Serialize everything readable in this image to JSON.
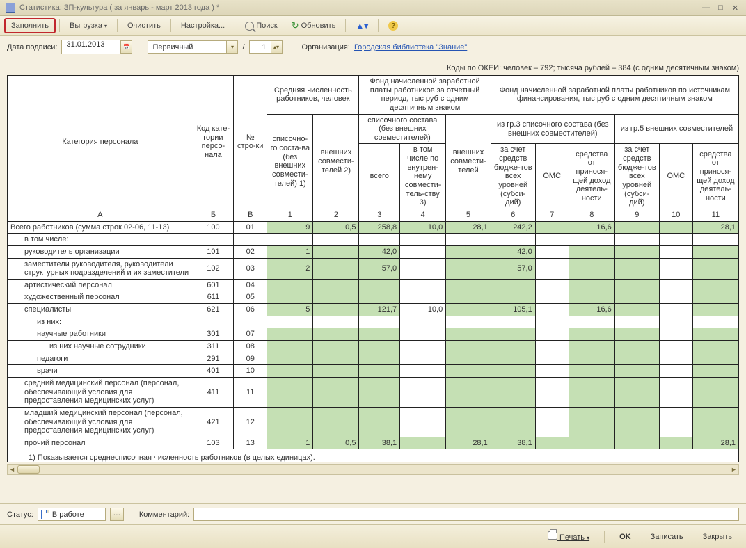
{
  "window": {
    "title": "Статистика: ЗП-культура ( за январь - март 2013 года ) *"
  },
  "toolbar": {
    "fill": "Заполнить",
    "export": "Выгрузка",
    "clear": "Очистить",
    "settings": "Настройка...",
    "search": "Поиск",
    "refresh": "Обновить"
  },
  "form": {
    "date_label": "Дата подписи:",
    "date_value": "31.01.2013",
    "doctype": "Первичный",
    "slash": "/",
    "seq": "1",
    "org_label": "Организация:",
    "org_value": "Городская библиотека \"Знание\""
  },
  "okei": "Коды по ОКЕИ: человек – 792; тысяча рублей – 384 (с одним десятичным знаком)",
  "head": {
    "cat": "Категория персонала",
    "code": "Код кате-гории персо-нала",
    "row": "№ стро-ки",
    "avg": "Средняя численность работников, человек",
    "fund_period": "Фонд начисленной заработной платы работников за отчетный период, тыс руб с одним десятичным знаком",
    "fund_src": "Фонд начисленной заработной платы работников по источникам финансирования, тыс руб с одним десятичным знаком",
    "list1": "списочно-го соста-ва (без внешних совмести-телей) 1)",
    "ext2": "внешних совмести-телей 2)",
    "list_noext": "списочного состава (без внешних совместителей)",
    "ext": "внешних совмести-телей",
    "total": "всего",
    "incl3": "в том числе по внутрен-нему совмести-тель-ству 3)",
    "from3": "из гр.3 списочного состава (без внешних совместителей)",
    "from5": "из гр.5 внешних совместителей",
    "budget": "за счет средств бюдже-тов всех уровней (субси-дий)",
    "oms": "ОМС",
    "income": "средства от принося-щей доход деятель-ности",
    "colA": "А",
    "colB": "Б",
    "colV": "В",
    "c1": "1",
    "c2": "2",
    "c3": "3",
    "c4": "4",
    "c5": "5",
    "c6": "6",
    "c7": "7",
    "c8": "8",
    "c9": "9",
    "c10": "10",
    "c11": "11"
  },
  "rows": [
    {
      "label": "Всего работников\n(сумма строк 02-06, 11-13)",
      "ind": 0,
      "code": "100",
      "n": "01",
      "v": [
        "9",
        "0,5",
        "258,8",
        "10,0",
        "28,1",
        "242,2",
        "",
        "16,6",
        "",
        "",
        "28,1"
      ],
      "g": [
        1,
        1,
        1,
        1,
        1,
        1,
        1,
        1,
        1,
        1,
        1
      ]
    },
    {
      "label": "в том числе:",
      "ind": 1,
      "code": "",
      "n": "",
      "v": [
        "",
        "",
        "",
        "",
        "",
        "",
        "",
        "",
        "",
        "",
        ""
      ],
      "g": [
        0,
        0,
        0,
        0,
        0,
        0,
        0,
        0,
        0,
        0,
        0
      ]
    },
    {
      "label": "руководитель организации",
      "ind": 1,
      "code": "101",
      "n": "02",
      "v": [
        "1",
        "",
        "42,0",
        "",
        "",
        "42,0",
        "",
        "",
        "",
        "",
        ""
      ],
      "g": [
        1,
        1,
        1,
        0,
        1,
        1,
        0,
        1,
        1,
        0,
        1
      ]
    },
    {
      "label": "заместители руководителя, руководители структурных подразделений и их заместители",
      "ind": 1,
      "code": "102",
      "n": "03",
      "v": [
        "2",
        "",
        "57,0",
        "",
        "",
        "57,0",
        "",
        "",
        "",
        "",
        ""
      ],
      "g": [
        1,
        1,
        1,
        0,
        1,
        1,
        0,
        1,
        1,
        0,
        1
      ]
    },
    {
      "label": "артистический персонал",
      "ind": 1,
      "code": "601",
      "n": "04",
      "v": [
        "",
        "",
        "",
        "",
        "",
        "",
        "",
        "",
        "",
        "",
        ""
      ],
      "g": [
        1,
        1,
        1,
        0,
        1,
        1,
        0,
        1,
        1,
        0,
        1
      ]
    },
    {
      "label": "художественный персонал",
      "ind": 1,
      "code": "611",
      "n": "05",
      "v": [
        "",
        "",
        "",
        "",
        "",
        "",
        "",
        "",
        "",
        "",
        ""
      ],
      "g": [
        1,
        1,
        1,
        0,
        1,
        1,
        0,
        1,
        1,
        0,
        1
      ]
    },
    {
      "label": "специалисты",
      "ind": 1,
      "code": "621",
      "n": "06",
      "v": [
        "5",
        "",
        "121,7",
        "10,0",
        "",
        "105,1",
        "",
        "16,6",
        "",
        "",
        ""
      ],
      "g": [
        1,
        1,
        1,
        0,
        1,
        1,
        0,
        1,
        1,
        0,
        1
      ]
    },
    {
      "label": "из них:",
      "ind": 2,
      "code": "",
      "n": "",
      "v": [
        "",
        "",
        "",
        "",
        "",
        "",
        "",
        "",
        "",
        "",
        ""
      ],
      "g": [
        0,
        0,
        0,
        0,
        0,
        0,
        0,
        0,
        0,
        0,
        0
      ]
    },
    {
      "label": "научные работники",
      "ind": 2,
      "code": "301",
      "n": "07",
      "v": [
        "",
        "",
        "",
        "",
        "",
        "",
        "",
        "",
        "",
        "",
        ""
      ],
      "g": [
        1,
        1,
        1,
        0,
        1,
        1,
        0,
        1,
        1,
        0,
        1
      ]
    },
    {
      "label": "из них научные сотрудники",
      "ind": 3,
      "code": "311",
      "n": "08",
      "v": [
        "",
        "",
        "",
        "",
        "",
        "",
        "",
        "",
        "",
        "",
        ""
      ],
      "g": [
        1,
        1,
        1,
        0,
        1,
        1,
        0,
        1,
        1,
        0,
        1
      ]
    },
    {
      "label": "педагоги",
      "ind": 2,
      "code": "291",
      "n": "09",
      "v": [
        "",
        "",
        "",
        "",
        "",
        "",
        "",
        "",
        "",
        "",
        ""
      ],
      "g": [
        1,
        1,
        1,
        0,
        1,
        1,
        0,
        1,
        1,
        0,
        1
      ]
    },
    {
      "label": "врачи",
      "ind": 2,
      "code": "401",
      "n": "10",
      "v": [
        "",
        "",
        "",
        "",
        "",
        "",
        "",
        "",
        "",
        "",
        ""
      ],
      "g": [
        1,
        1,
        1,
        0,
        1,
        1,
        0,
        1,
        1,
        0,
        1
      ]
    },
    {
      "label": "средний медицинский персонал (персонал, обеспечивающий условия для предоставления медицинских услуг)",
      "ind": 1,
      "code": "411",
      "n": "11",
      "v": [
        "",
        "",
        "",
        "",
        "",
        "",
        "",
        "",
        "",
        "",
        ""
      ],
      "g": [
        1,
        1,
        1,
        0,
        1,
        1,
        0,
        1,
        1,
        0,
        1
      ]
    },
    {
      "label": "младший медицинский персонал (персонал, обеспечивающий условия для предоставления медицинских услуг)",
      "ind": 1,
      "code": "421",
      "n": "12",
      "v": [
        "",
        "",
        "",
        "",
        "",
        "",
        "",
        "",
        "",
        "",
        ""
      ],
      "g": [
        1,
        1,
        1,
        0,
        1,
        1,
        0,
        1,
        1,
        0,
        1
      ]
    },
    {
      "label": "прочий персонал",
      "ind": 1,
      "code": "103",
      "n": "13",
      "v": [
        "1",
        "0,5",
        "38,1",
        "",
        "28,1",
        "38,1",
        "",
        "",
        "",
        "",
        "28,1"
      ],
      "g": [
        1,
        1,
        1,
        1,
        1,
        1,
        1,
        1,
        1,
        1,
        1
      ]
    }
  ],
  "footnote": "1) Показывается среднесписочная численность работников (в целых единицах).",
  "status": {
    "label": "Статус:",
    "value": "В работе",
    "comment_label": "Комментарий:"
  },
  "bottom": {
    "print": "Печать",
    "ok": "OK",
    "save": "Записать",
    "close": "Закрыть"
  }
}
